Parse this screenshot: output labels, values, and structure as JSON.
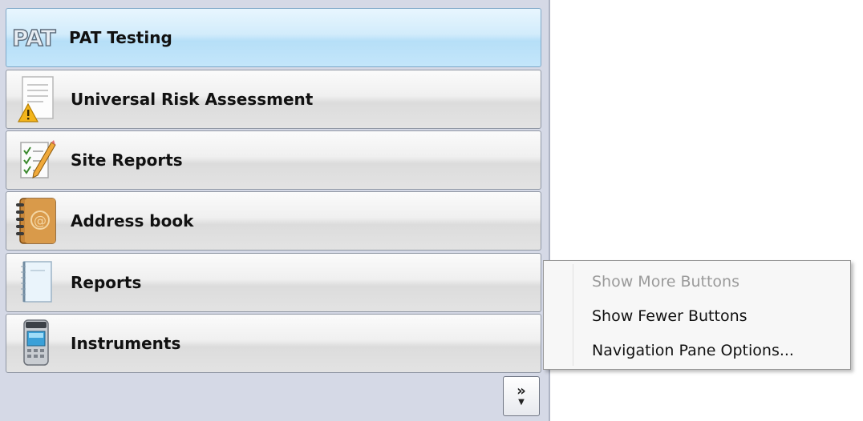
{
  "nav_buttons": [
    {
      "label": "PAT Testing",
      "icon": "pat-logo-icon",
      "selected": true
    },
    {
      "label": "Universal Risk Assessment",
      "icon": "risk-document-icon",
      "selected": false
    },
    {
      "label": "Site Reports",
      "icon": "checklist-pencil-icon",
      "selected": false
    },
    {
      "label": "Address book",
      "icon": "address-book-icon",
      "selected": false
    },
    {
      "label": "Reports",
      "icon": "notepad-icon",
      "selected": false
    },
    {
      "label": "Instruments",
      "icon": "tester-device-icon",
      "selected": false
    }
  ],
  "pat_logo_text": "PAT",
  "chevron_button": {
    "icon": "chevron-double-right-icon"
  },
  "context_menu": {
    "items": [
      {
        "label": "Show More Buttons",
        "enabled": false
      },
      {
        "label": "Show Fewer Buttons",
        "enabled": true
      },
      {
        "label": "Navigation Pane Options...",
        "enabled": true
      }
    ]
  },
  "colors": {
    "selected_button": "#bfe4f8",
    "pane_background": "#d5d9e6",
    "disabled_text": "#9a9a9a"
  }
}
